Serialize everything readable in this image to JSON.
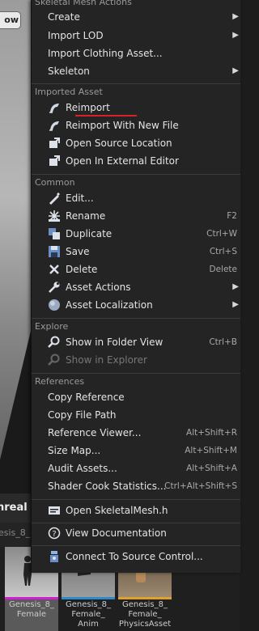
{
  "background": {
    "button_label": "ow",
    "unreal_label": "nreal",
    "tab_label": "esis_8_",
    "assets": [
      {
        "label": "Genesis_8_ Female",
        "bar_color": "#d01fd2",
        "selected": true
      },
      {
        "label": "Genesis_8_ Female_ Anim",
        "bar_color": "#2f8ac8",
        "selected": false
      },
      {
        "label": "Genesis_8_ Female_ PhysicsAsset",
        "bar_color": "#e0a030",
        "selected": false
      }
    ]
  },
  "menu": {
    "header_partial": "Skeletal Mesh Actions",
    "skeletal": [
      {
        "label": "Create",
        "submenu": true
      },
      {
        "label": "Import LOD",
        "submenu": true
      },
      {
        "label": "Import Clothing Asset...",
        "submenu": false
      },
      {
        "label": "Skeleton",
        "submenu": true
      }
    ],
    "imported_header": "Imported Asset",
    "imported": [
      {
        "label": "Reimport",
        "icon": "reimport-icon"
      },
      {
        "label": "Reimport With New File",
        "icon": "reimport-new-file-icon"
      },
      {
        "label": "Open Source Location",
        "icon": "open-source-location-icon"
      },
      {
        "label": "Open In External Editor",
        "icon": "external-editor-icon"
      }
    ],
    "common_header": "Common",
    "common": [
      {
        "label": "Edit...",
        "shortcut": "",
        "icon": "edit-icon"
      },
      {
        "label": "Rename",
        "shortcut": "F2",
        "icon": "rename-icon"
      },
      {
        "label": "Duplicate",
        "shortcut": "Ctrl+W",
        "icon": "duplicate-icon"
      },
      {
        "label": "Save",
        "shortcut": "Ctrl+S",
        "icon": "save-icon"
      },
      {
        "label": "Delete",
        "shortcut": "Delete",
        "icon": "delete-icon"
      },
      {
        "label": "Asset Actions",
        "submenu": true,
        "icon": "wrench-icon"
      },
      {
        "label": "Asset Localization",
        "submenu": true,
        "icon": "globe-icon"
      }
    ],
    "explore_header": "Explore",
    "explore": [
      {
        "label": "Show in Folder View",
        "shortcut": "Ctrl+B",
        "icon": "magnifier-icon"
      },
      {
        "label": "Show in Explorer",
        "shortcut": "",
        "icon": "magnifier-icon",
        "disabled": true
      }
    ],
    "references_header": "References",
    "references": [
      {
        "label": "Copy Reference",
        "shortcut": ""
      },
      {
        "label": "Copy File Path",
        "shortcut": ""
      },
      {
        "label": "Reference Viewer...",
        "shortcut": "Alt+Shift+R"
      },
      {
        "label": "Size Map...",
        "shortcut": "Alt+Shift+M"
      },
      {
        "label": "Audit Assets...",
        "shortcut": "Alt+Shift+A"
      },
      {
        "label": "Shader Cook Statistics...",
        "shortcut": "Ctrl+Alt+Shift+S"
      }
    ],
    "open_header_item": "Open SkeletalMesh.h",
    "docs_item": "View Documentation",
    "source_control_item": "Connect To Source Control..."
  }
}
